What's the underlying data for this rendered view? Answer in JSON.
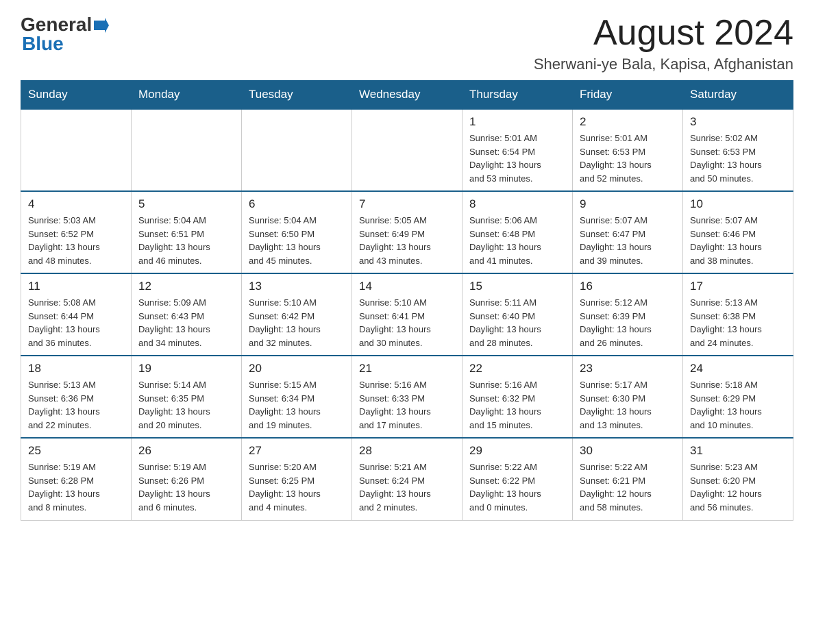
{
  "header": {
    "logo_line1": "General",
    "logo_line2": "Blue",
    "month_title": "August 2024",
    "location": "Sherwani-ye Bala, Kapisa, Afghanistan"
  },
  "days_of_week": [
    "Sunday",
    "Monday",
    "Tuesday",
    "Wednesday",
    "Thursday",
    "Friday",
    "Saturday"
  ],
  "weeks": [
    [
      {
        "day": "",
        "info": ""
      },
      {
        "day": "",
        "info": ""
      },
      {
        "day": "",
        "info": ""
      },
      {
        "day": "",
        "info": ""
      },
      {
        "day": "1",
        "info": "Sunrise: 5:01 AM\nSunset: 6:54 PM\nDaylight: 13 hours\nand 53 minutes."
      },
      {
        "day": "2",
        "info": "Sunrise: 5:01 AM\nSunset: 6:53 PM\nDaylight: 13 hours\nand 52 minutes."
      },
      {
        "day": "3",
        "info": "Sunrise: 5:02 AM\nSunset: 6:53 PM\nDaylight: 13 hours\nand 50 minutes."
      }
    ],
    [
      {
        "day": "4",
        "info": "Sunrise: 5:03 AM\nSunset: 6:52 PM\nDaylight: 13 hours\nand 48 minutes."
      },
      {
        "day": "5",
        "info": "Sunrise: 5:04 AM\nSunset: 6:51 PM\nDaylight: 13 hours\nand 46 minutes."
      },
      {
        "day": "6",
        "info": "Sunrise: 5:04 AM\nSunset: 6:50 PM\nDaylight: 13 hours\nand 45 minutes."
      },
      {
        "day": "7",
        "info": "Sunrise: 5:05 AM\nSunset: 6:49 PM\nDaylight: 13 hours\nand 43 minutes."
      },
      {
        "day": "8",
        "info": "Sunrise: 5:06 AM\nSunset: 6:48 PM\nDaylight: 13 hours\nand 41 minutes."
      },
      {
        "day": "9",
        "info": "Sunrise: 5:07 AM\nSunset: 6:47 PM\nDaylight: 13 hours\nand 39 minutes."
      },
      {
        "day": "10",
        "info": "Sunrise: 5:07 AM\nSunset: 6:46 PM\nDaylight: 13 hours\nand 38 minutes."
      }
    ],
    [
      {
        "day": "11",
        "info": "Sunrise: 5:08 AM\nSunset: 6:44 PM\nDaylight: 13 hours\nand 36 minutes."
      },
      {
        "day": "12",
        "info": "Sunrise: 5:09 AM\nSunset: 6:43 PM\nDaylight: 13 hours\nand 34 minutes."
      },
      {
        "day": "13",
        "info": "Sunrise: 5:10 AM\nSunset: 6:42 PM\nDaylight: 13 hours\nand 32 minutes."
      },
      {
        "day": "14",
        "info": "Sunrise: 5:10 AM\nSunset: 6:41 PM\nDaylight: 13 hours\nand 30 minutes."
      },
      {
        "day": "15",
        "info": "Sunrise: 5:11 AM\nSunset: 6:40 PM\nDaylight: 13 hours\nand 28 minutes."
      },
      {
        "day": "16",
        "info": "Sunrise: 5:12 AM\nSunset: 6:39 PM\nDaylight: 13 hours\nand 26 minutes."
      },
      {
        "day": "17",
        "info": "Sunrise: 5:13 AM\nSunset: 6:38 PM\nDaylight: 13 hours\nand 24 minutes."
      }
    ],
    [
      {
        "day": "18",
        "info": "Sunrise: 5:13 AM\nSunset: 6:36 PM\nDaylight: 13 hours\nand 22 minutes."
      },
      {
        "day": "19",
        "info": "Sunrise: 5:14 AM\nSunset: 6:35 PM\nDaylight: 13 hours\nand 20 minutes."
      },
      {
        "day": "20",
        "info": "Sunrise: 5:15 AM\nSunset: 6:34 PM\nDaylight: 13 hours\nand 19 minutes."
      },
      {
        "day": "21",
        "info": "Sunrise: 5:16 AM\nSunset: 6:33 PM\nDaylight: 13 hours\nand 17 minutes."
      },
      {
        "day": "22",
        "info": "Sunrise: 5:16 AM\nSunset: 6:32 PM\nDaylight: 13 hours\nand 15 minutes."
      },
      {
        "day": "23",
        "info": "Sunrise: 5:17 AM\nSunset: 6:30 PM\nDaylight: 13 hours\nand 13 minutes."
      },
      {
        "day": "24",
        "info": "Sunrise: 5:18 AM\nSunset: 6:29 PM\nDaylight: 13 hours\nand 10 minutes."
      }
    ],
    [
      {
        "day": "25",
        "info": "Sunrise: 5:19 AM\nSunset: 6:28 PM\nDaylight: 13 hours\nand 8 minutes."
      },
      {
        "day": "26",
        "info": "Sunrise: 5:19 AM\nSunset: 6:26 PM\nDaylight: 13 hours\nand 6 minutes."
      },
      {
        "day": "27",
        "info": "Sunrise: 5:20 AM\nSunset: 6:25 PM\nDaylight: 13 hours\nand 4 minutes."
      },
      {
        "day": "28",
        "info": "Sunrise: 5:21 AM\nSunset: 6:24 PM\nDaylight: 13 hours\nand 2 minutes."
      },
      {
        "day": "29",
        "info": "Sunrise: 5:22 AM\nSunset: 6:22 PM\nDaylight: 13 hours\nand 0 minutes."
      },
      {
        "day": "30",
        "info": "Sunrise: 5:22 AM\nSunset: 6:21 PM\nDaylight: 12 hours\nand 58 minutes."
      },
      {
        "day": "31",
        "info": "Sunrise: 5:23 AM\nSunset: 6:20 PM\nDaylight: 12 hours\nand 56 minutes."
      }
    ]
  ]
}
